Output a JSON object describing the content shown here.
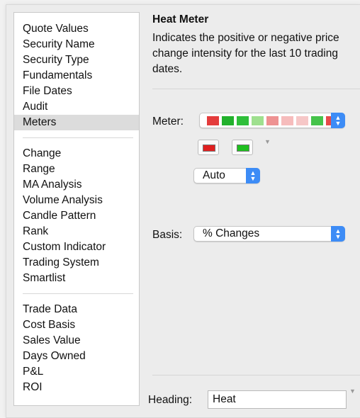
{
  "sidebar": {
    "groups": [
      [
        "Quote Values",
        "Security Name",
        "Security Type",
        "Fundamentals",
        "File Dates",
        "Audit",
        "Meters"
      ],
      [
        "Change",
        "Range",
        "MA Analysis",
        "Volume Analysis",
        "Candle Pattern",
        "Rank",
        "Custom Indicator",
        "Trading System",
        "Smartlist"
      ],
      [
        "Trade Data",
        "Cost Basis",
        "Sales Value",
        "Days Owned",
        "P&L",
        "ROI"
      ]
    ],
    "selected": "Meters"
  },
  "panel": {
    "title": "Heat Meter",
    "description": "Indicates the positive or negative price change intensity for the last 10 trading dates.",
    "meter_label": "Meter:",
    "meter_swatches": [
      "#e43c3c",
      "#22b12c",
      "#2fbf3a",
      "#9fe08f",
      "#ee9292",
      "#f6bcbc",
      "#f6c7c7",
      "#45c34a",
      "#e74a4a"
    ],
    "color_negative": "#e02020",
    "color_positive": "#1fbf1f",
    "auto_value": "Auto",
    "basis_label": "Basis:",
    "basis_value": "% Changes",
    "heading_label": "Heading:",
    "heading_value": "Heat"
  },
  "icons": {
    "stepper": "up-down-arrows-icon",
    "dropdown": "triangle-down-icon"
  }
}
